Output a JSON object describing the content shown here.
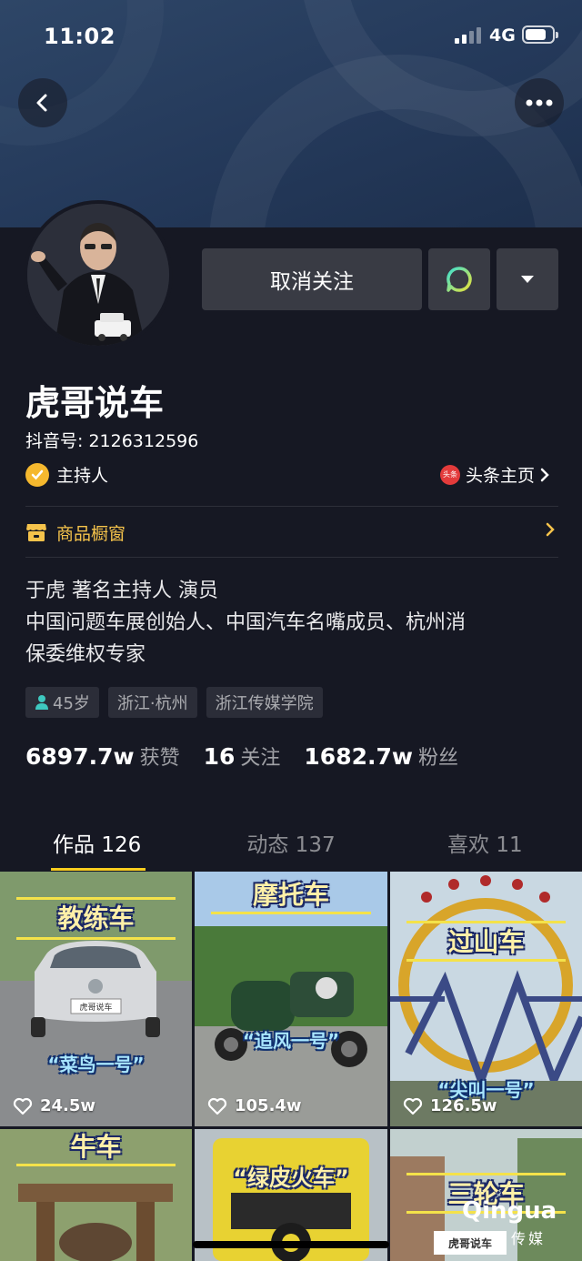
{
  "status_bar": {
    "time": "11:02",
    "network": "4G"
  },
  "profile": {
    "name": "虎哥说车",
    "douyin_id_label": "抖音号: ",
    "douyin_id": "2126312596",
    "verify_label": "主持人",
    "toutiao_label": "头条主页",
    "toutiao_icon_text": "头条",
    "shop_label": "商品橱窗",
    "bio_lines": [
      "于虎 著名主持人 演员",
      "中国问题车展创始人、中国汽车名嘴成员、杭州消",
      "保委维权专家"
    ],
    "tags": [
      "45岁",
      "浙江·杭州",
      "浙江传媒学院"
    ]
  },
  "actions": {
    "unfollow_label": "取消关注"
  },
  "stats": [
    {
      "value": "6897.7w",
      "label": "获赞"
    },
    {
      "value": "16",
      "label": "关注"
    },
    {
      "value": "1682.7w",
      "label": "粉丝"
    }
  ],
  "tabs": [
    "作品 126",
    "动态 137",
    "喜欢 11"
  ],
  "videos": [
    {
      "caption": "教练车",
      "subtitle": "“菜鸟一号”",
      "likes": "24.5w",
      "plate": "虎哥说车"
    },
    {
      "caption": "摩托车",
      "subtitle": "“追风一号”",
      "likes": "105.4w"
    },
    {
      "caption": "过山车",
      "subtitle": "“尖叫一号”",
      "likes": "126.5w"
    },
    {
      "caption": "牛车"
    },
    {
      "caption": "“绿皮火车”"
    },
    {
      "caption": "三轮车",
      "plate": "虎哥说车"
    }
  ],
  "watermark": {
    "main": "Qingua",
    "sub": "传媒"
  },
  "colors": {
    "background": "#161823",
    "accent": "#facd1e",
    "button": "#393b44",
    "shop": "#f5c34b",
    "verify": "#f5b82e"
  }
}
